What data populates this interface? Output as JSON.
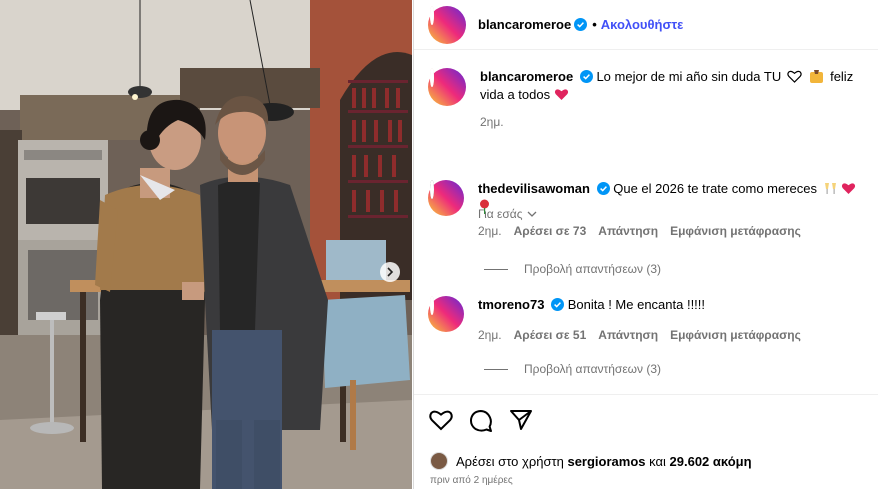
{
  "post": {
    "author": "blancaromeroe",
    "follow_label": "Ακολουθήστε",
    "separator": "•"
  },
  "caption": {
    "username": "blancaromeroe",
    "text_a": "Lo mejor de mi año sin duda TU",
    "text_b": "feliz vida a todos",
    "time": "2ημ."
  },
  "for_you_label": "Για εσάς",
  "comments": [
    {
      "username": "thedevilisawoman",
      "text": "Que el 2026 te trate como mereces",
      "time": "2ημ.",
      "likes": "Αρέσει σε 73",
      "reply": "Απάντηση",
      "translate": "Εμφάνιση μετάφρασης",
      "view_replies": "Προβολή απαντήσεων (3)"
    },
    {
      "username": "tmoreno73",
      "text": "Bonita ! Me encanta !!!!!",
      "time": "2ημ.",
      "likes": "Αρέσει σε 51",
      "reply": "Απάντηση",
      "translate": "Εμφάνιση μετάφρασης",
      "view_replies": "Προβολή απαντήσεων (3)"
    }
  ],
  "likes_line": {
    "prefix": "Αρέσει στο χρήστη",
    "user": "sergioramos",
    "middle": "και",
    "count": "29.602 ακόμη"
  },
  "posted_time": "πριν από 2 ημέρες",
  "colors": {
    "accent": "#4150f7",
    "verified": "#0095f6",
    "heart_red": "#e0245e"
  },
  "icons": [
    "heart-icon",
    "comment-icon",
    "share-icon",
    "verified-icon",
    "chevron-down-icon",
    "chevron-right-icon"
  ]
}
